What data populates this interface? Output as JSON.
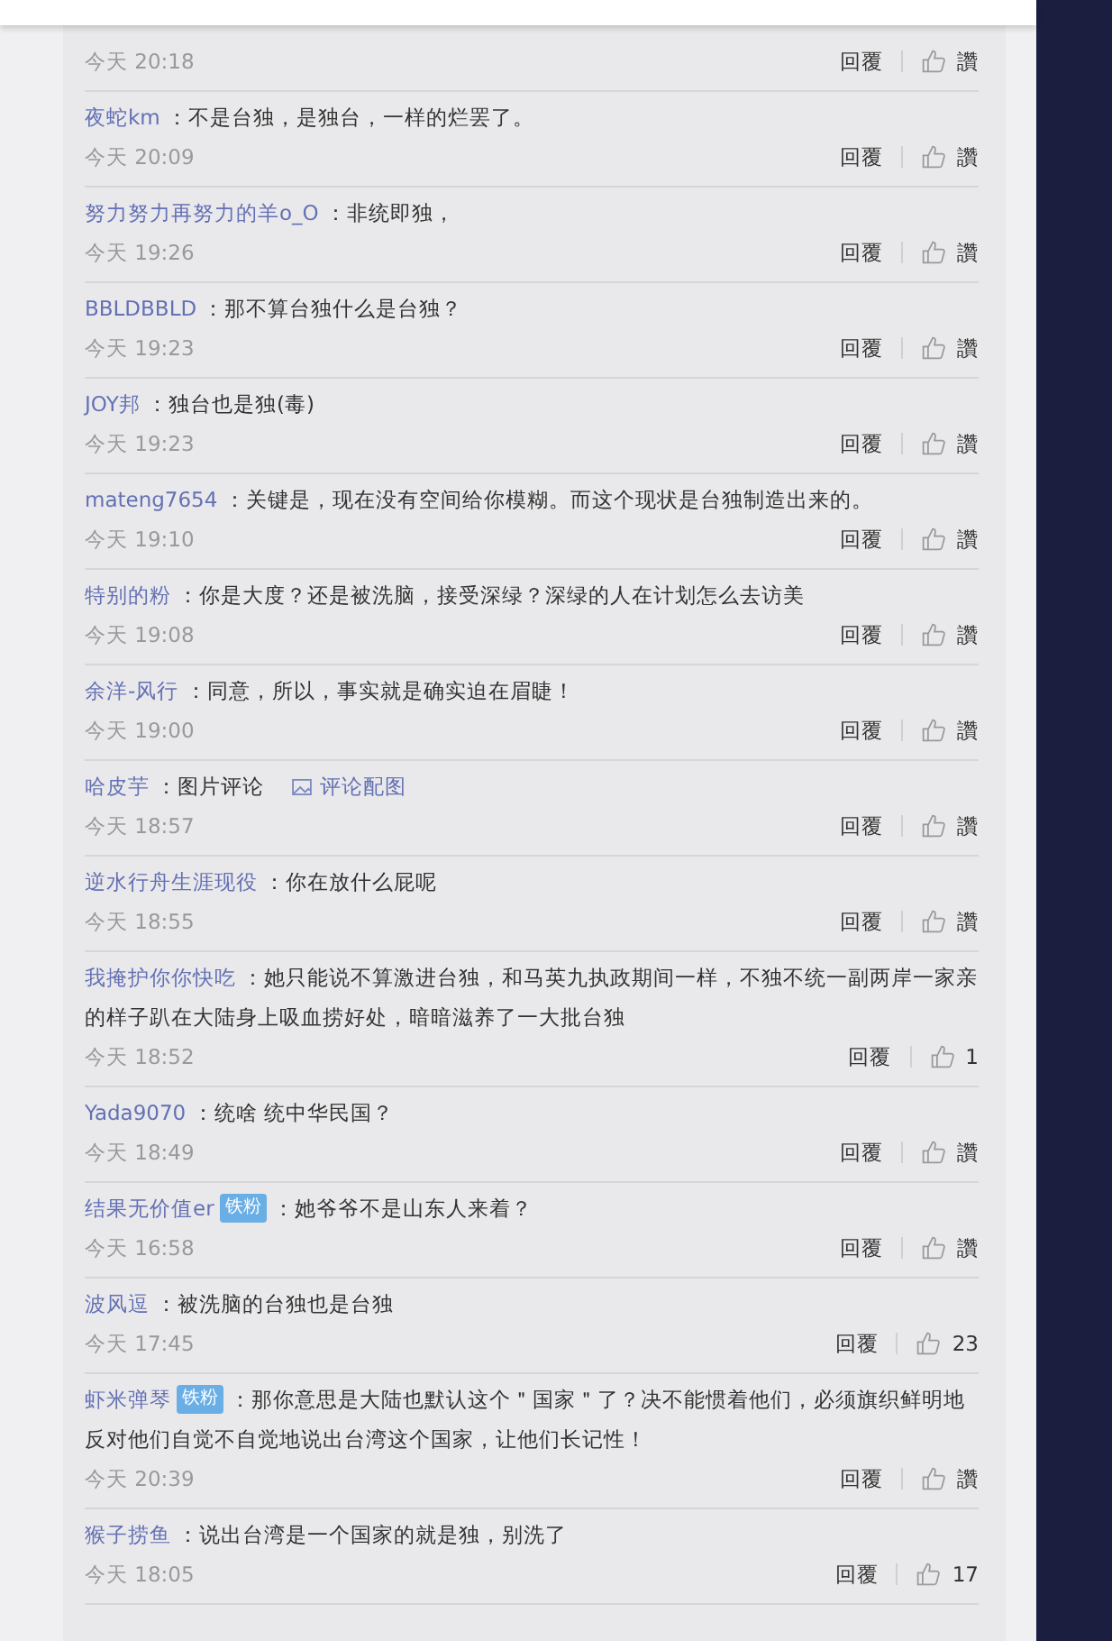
{
  "comments": [
    {
      "time": "今天 20:18",
      "reply": "回覆",
      "like": "讚"
    },
    {
      "user": "夜蛇km",
      "text": "：不是台独，是独台，一样的烂罢了。",
      "time": "今天 20:09",
      "reply": "回覆",
      "like": "讚"
    },
    {
      "user": "努力努力再努力的羊o_O",
      "text": "：非统即独，",
      "time": "今天 19:26",
      "reply": "回覆",
      "like": "讚"
    },
    {
      "user": "BBLDBBLD",
      "text": "：那不算台独什么是台独？",
      "time": "今天 19:23",
      "reply": "回覆",
      "like": "讚"
    },
    {
      "user": "JOY邦",
      "text": "：独台也是独(毒)",
      "time": "今天 19:23",
      "reply": "回覆",
      "like": "讚"
    },
    {
      "user": "mateng7654",
      "text": "：关键是，现在没有空间给你模糊。而这个现状是台独制造出来的。",
      "time": "今天 19:10",
      "reply": "回覆",
      "like": "讚"
    },
    {
      "user": "特别的粉",
      "text": "：你是大度？还是被洗脑，接受深绿？深绿的人在计划怎么去访美",
      "time": "今天 19:08",
      "reply": "回覆",
      "like": "讚"
    },
    {
      "user": "余洋-风行",
      "text": "：同意，所以，事实就是确实迫在眉睫！",
      "time": "今天 19:00",
      "reply": "回覆",
      "like": "讚"
    },
    {
      "user": "哈皮芋",
      "text": "：图片评论",
      "attachment": "评论配图",
      "time": "今天 18:57",
      "reply": "回覆",
      "like": "讚"
    },
    {
      "user": "逆水行舟生涯现役",
      "text": "：你在放什么屁呢",
      "time": "今天 18:55",
      "reply": "回覆",
      "like": "讚"
    },
    {
      "user": "我掩护你你快吃",
      "text": "：她只能说不算激进台独，和马英九执政期间一样，不独不统一副两岸一家亲的样子趴在大陆身上吸血捞好处，暗暗滋养了一大批台独",
      "time": "今天 18:52",
      "reply": "回覆",
      "like": "1"
    },
    {
      "user": "Yada9070",
      "text": "：统啥 统中华民国？",
      "time": "今天 18:49",
      "reply": "回覆",
      "like": "讚"
    },
    {
      "user": "结果无价值er",
      "badge": "铁粉",
      "text": "：她爷爷不是山东人来着？",
      "time": "今天 16:58",
      "reply": "回覆",
      "like": "讚"
    },
    {
      "user": "波风逗",
      "text": "：被洗脑的台独也是台独",
      "time": "今天 17:45",
      "reply": "回覆",
      "like": "23"
    },
    {
      "user": "虾米弹琴",
      "badge": "铁粉",
      "text": "：那你意思是大陆也默认这个＂国家＂了？决不能惯着他们，必须旗织鲜明地反对他们自觉不自觉地说出台湾这个国家，让他们长记性！",
      "time": "今天 20:39",
      "reply": "回覆",
      "like": "讚"
    },
    {
      "user": "猴子捞鱼",
      "text": "：说出台湾是一个国家的就是独，别洗了",
      "time": "今天 18:05",
      "reply": "回覆",
      "like": "17"
    }
  ]
}
